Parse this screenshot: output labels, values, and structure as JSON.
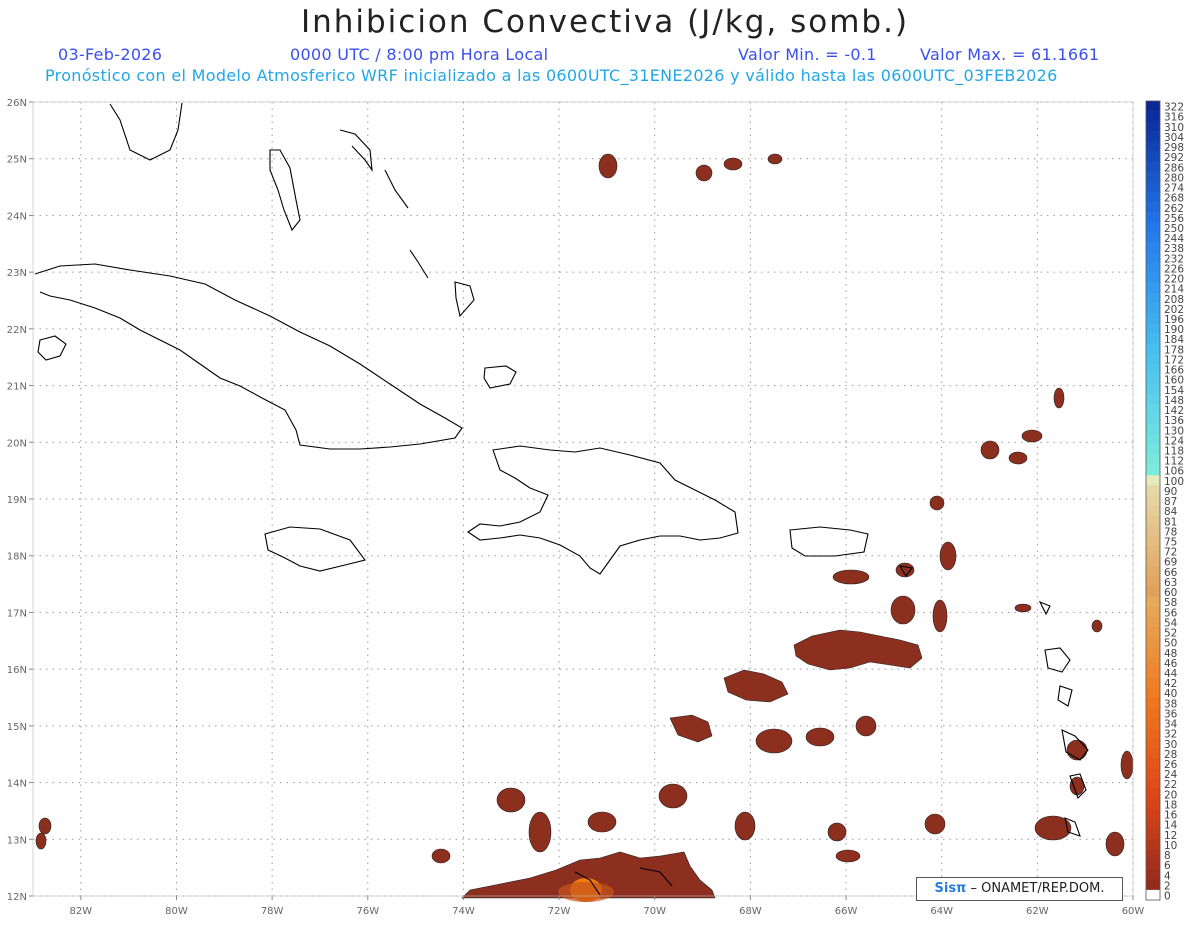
{
  "header": {
    "title": "Inhibicion Convectiva (J/kg, somb.)",
    "date": "03-Feb-2026",
    "time": "0000 UTC / 8:00 pm Hora Local",
    "value_min": "Valor Min. = -0.1",
    "value_max": "Valor Max. = 61.1661",
    "forecast": "Pronóstico con el Modelo Atmosferico WRF inicializado a las 0600UTC_31ENE2026 y válido hasta las  0600UTC_03FEB2026"
  },
  "map": {
    "lat_labels": [
      "26N",
      "25N",
      "24N",
      "23N",
      "22N",
      "21N",
      "20N",
      "19N",
      "18N",
      "17N",
      "16N",
      "15N",
      "14N",
      "13N",
      "12N"
    ],
    "lon_labels": [
      "82W",
      "80W",
      "78W",
      "76W",
      "74W",
      "72W",
      "70W",
      "68W",
      "66W",
      "64W",
      "62W",
      "60W"
    ],
    "lat_values": [
      26,
      25,
      24,
      23,
      22,
      21,
      20,
      19,
      18,
      17,
      16,
      15,
      14,
      13,
      12
    ],
    "lon_values": [
      -82,
      -80,
      -78,
      -76,
      -74,
      -72,
      -70,
      -68,
      -66,
      -64,
      -62,
      -60
    ],
    "shading_color": "#8c2f1f",
    "max_color": "#f07a10"
  },
  "colorbar": {
    "labels": [
      "322",
      "316",
      "310",
      "304",
      "298",
      "292",
      "286",
      "280",
      "274",
      "268",
      "262",
      "256",
      "250",
      "244",
      "238",
      "232",
      "226",
      "220",
      "214",
      "208",
      "202",
      "196",
      "190",
      "184",
      "178",
      "172",
      "166",
      "160",
      "154",
      "148",
      "142",
      "136",
      "130",
      "124",
      "118",
      "112",
      "106",
      "100",
      "90",
      "87",
      "84",
      "81",
      "78",
      "75",
      "72",
      "69",
      "66",
      "63",
      "60",
      "58",
      "56",
      "54",
      "52",
      "50",
      "48",
      "46",
      "44",
      "42",
      "40",
      "38",
      "36",
      "34",
      "32",
      "30",
      "28",
      "26",
      "24",
      "22",
      "20",
      "18",
      "16",
      "14",
      "12",
      "10",
      "8",
      "6",
      "4",
      "2",
      "0"
    ]
  },
  "credit": {
    "brand": "Sisπ",
    "text": " – ONAMET/REP.DOM."
  }
}
